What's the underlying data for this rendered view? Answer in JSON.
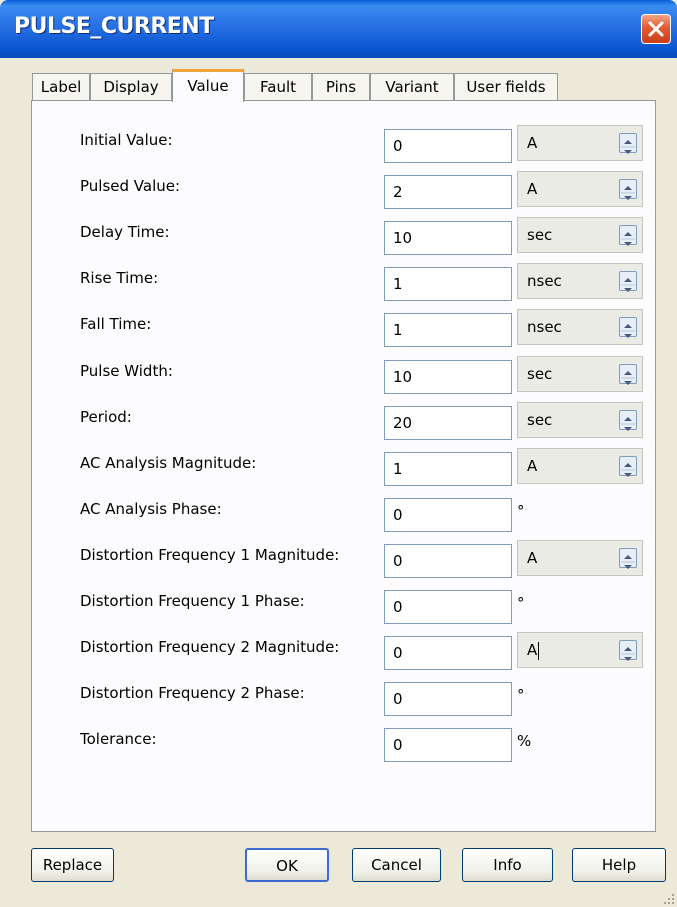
{
  "window": {
    "title": "PULSE_CURRENT"
  },
  "tabs": [
    "Label",
    "Display",
    "Value",
    "Fault",
    "Pins",
    "Variant",
    "User fields"
  ],
  "active_tab": "Value",
  "params": [
    {
      "label": "Initial Value:",
      "value": "0",
      "unit": "A",
      "unit_type": "select"
    },
    {
      "label": "Pulsed Value:",
      "value": "2",
      "unit": "A",
      "unit_type": "select"
    },
    {
      "label": "Delay Time:",
      "value": "10",
      "unit": "sec",
      "unit_type": "select"
    },
    {
      "label": "Rise Time:",
      "value": "1",
      "unit": "nsec",
      "unit_type": "select"
    },
    {
      "label": "Fall Time:",
      "value": "1",
      "unit": "nsec",
      "unit_type": "select"
    },
    {
      "label": "Pulse Width:",
      "value": "10",
      "unit": "sec",
      "unit_type": "select"
    },
    {
      "label": "Period:",
      "value": "20",
      "unit": "sec",
      "unit_type": "select"
    },
    {
      "label": "AC Analysis Magnitude:",
      "value": "1",
      "unit": "A",
      "unit_type": "select"
    },
    {
      "label": "AC Analysis Phase:",
      "value": "0",
      "unit": "°",
      "unit_type": "text"
    },
    {
      "label": "Distortion Frequency 1 Magnitude:",
      "value": "0",
      "unit": "A",
      "unit_type": "select"
    },
    {
      "label": "Distortion Frequency 1 Phase:",
      "value": "0",
      "unit": "°",
      "unit_type": "text"
    },
    {
      "label": "Distortion Frequency 2 Magnitude:",
      "value": "0",
      "unit": "A",
      "unit_type": "select",
      "caret": true
    },
    {
      "label": "Distortion Frequency 2 Phase:",
      "value": "0",
      "unit": "°",
      "unit_type": "text"
    },
    {
      "label": "Tolerance:",
      "value": "0",
      "unit": "%",
      "unit_type": "text"
    }
  ],
  "buttons": {
    "replace": "Replace",
    "ok": "OK",
    "cancel": "Cancel",
    "info": "Info",
    "help": "Help"
  },
  "icons": {
    "close": "close-icon",
    "spin": "spin-updown-icon",
    "grip": "resize-grip-icon"
  },
  "colors": {
    "title_bar": "#2b74e6",
    "close_button": "#e25a31",
    "active_tab_accent": "#f2a43a",
    "dialog_bg": "#ece9d8"
  }
}
